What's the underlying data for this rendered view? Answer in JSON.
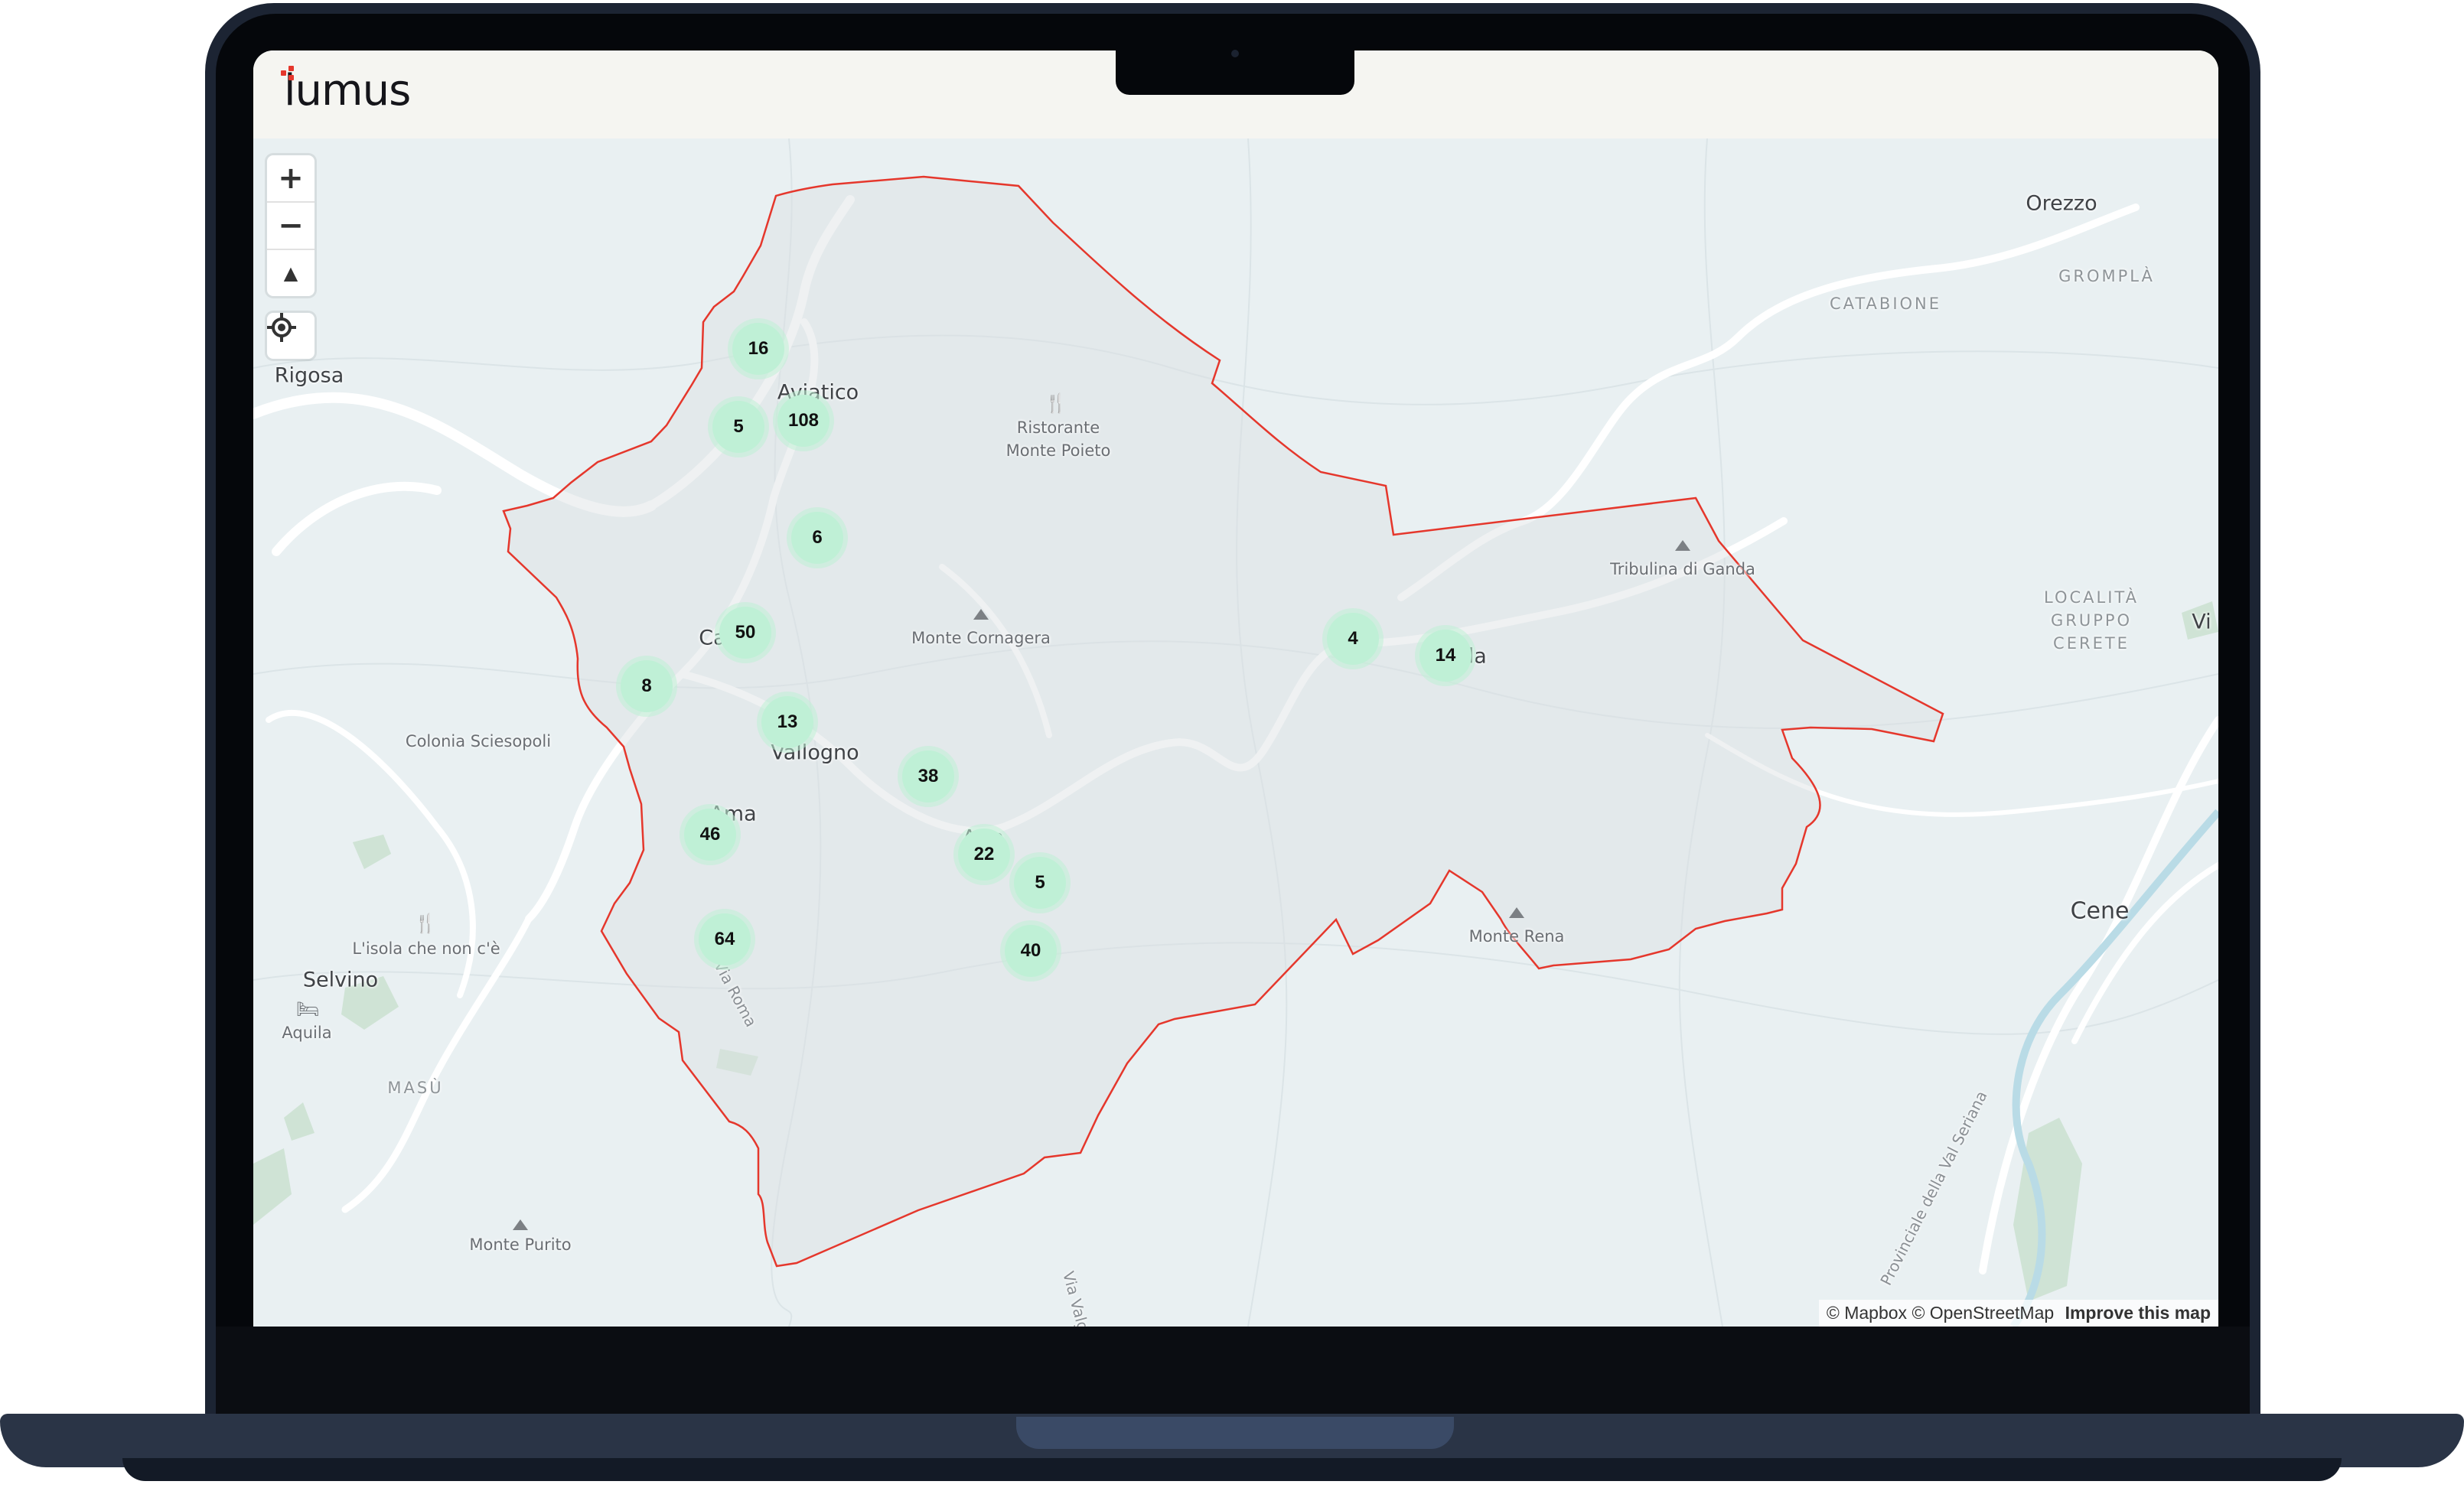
{
  "app": {
    "logo_text": "lumus",
    "brand_color": "#e5372c"
  },
  "map_controls": {
    "zoom_in": "+",
    "zoom_out": "−",
    "compass": "▲",
    "locate_icon": "crosshair-icon"
  },
  "boundary_color": "#e5372c",
  "clusters": [
    {
      "count": "16"
    },
    {
      "count": "5"
    },
    {
      "count": "108"
    },
    {
      "count": "6"
    },
    {
      "count": "50"
    },
    {
      "count": "8"
    },
    {
      "count": "13"
    },
    {
      "count": "38"
    },
    {
      "count": "46"
    },
    {
      "count": "22"
    },
    {
      "count": "5"
    },
    {
      "count": "64"
    },
    {
      "count": "40"
    },
    {
      "count": "4"
    },
    {
      "count": "14"
    }
  ],
  "places": {
    "orezzo": "Orezzo",
    "catabione": "CATABIONE",
    "grompla": "GROMPLÀ",
    "rigosa": "Rigosa",
    "aviatico": "Aviatico",
    "ristorante": "Ristorante",
    "monte_poieto": "Monte Poieto",
    "monte_cornagera": "Monte Cornagera",
    "tribulina": "Tribulina di Ganda",
    "localita_1": "LOCALITÀ",
    "localita_2": "GRUPPO",
    "localita_3": "CERETE",
    "ca": "Ca",
    "ganda_partial": "da",
    "colonia": "Colonia Sciesopoli",
    "vallogno": "Vallogno",
    "ama": "Ama",
    "amora_partial": "A        ra",
    "isola": "L'isola che non c'è",
    "selvino": "Selvino",
    "aquila": "Aquila",
    "masu": "MASÙ",
    "monte_purito": "Monte Purito",
    "monte_rena": "Monte Rena",
    "cene": "Cene",
    "via_roma": "Via Roma",
    "via_valg": "Via Valg",
    "provinciale": "Provinciale della Val Seriana",
    "vi": "Vi"
  },
  "attribution": {
    "mapbox": "© Mapbox",
    "osm": "© OpenStreetMap",
    "improve": "Improve this map"
  }
}
